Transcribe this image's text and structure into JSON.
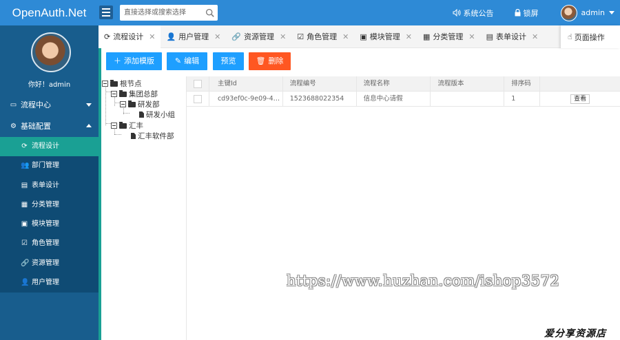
{
  "app": {
    "brand": "OpenAuth.Net"
  },
  "header": {
    "search_placeholder": "直接选择或搜索选择",
    "notice_label": "系统公告",
    "lock_label": "锁屏",
    "user_name": "admin"
  },
  "sidebar": {
    "greeting": "你好！admin",
    "groups": [
      {
        "label": "流程中心",
        "icon": "monitor-icon",
        "expanded": false
      },
      {
        "label": "基础配置",
        "icon": "gear-icon",
        "expanded": true
      }
    ],
    "items": [
      {
        "label": "流程设计",
        "icon": "refresh-icon",
        "active": true
      },
      {
        "label": "部门管理",
        "icon": "users-icon",
        "active": false
      },
      {
        "label": "表单设计",
        "icon": "form-icon",
        "active": false
      },
      {
        "label": "分类管理",
        "icon": "grid-icon",
        "active": false
      },
      {
        "label": "模块管理",
        "icon": "module-icon",
        "active": false
      },
      {
        "label": "角色管理",
        "icon": "check-square-icon",
        "active": false
      },
      {
        "label": "资源管理",
        "icon": "link-icon",
        "active": false
      },
      {
        "label": "用户管理",
        "icon": "user-icon",
        "active": false
      }
    ]
  },
  "tabs": [
    {
      "label": "流程设计",
      "icon": "refresh-icon",
      "active": true
    },
    {
      "label": "用户管理",
      "icon": "user-icon",
      "active": false
    },
    {
      "label": "资源管理",
      "icon": "link-icon",
      "active": false
    },
    {
      "label": "角色管理",
      "icon": "check-square-icon",
      "active": false
    },
    {
      "label": "模块管理",
      "icon": "module-icon",
      "active": false
    },
    {
      "label": "分类管理",
      "icon": "grid-icon",
      "active": false
    },
    {
      "label": "表单设计",
      "icon": "form-icon",
      "active": false
    }
  ],
  "page_action": {
    "label": "页面操作",
    "icon": "hand-pointer-icon"
  },
  "toolbar": {
    "add_label": "添加模版",
    "edit_label": "编辑",
    "preview_label": "预览",
    "delete_label": "删除",
    "colors": {
      "blue": "#1e9fff",
      "red": "#ff5722",
      "active_green": "#1aa094"
    }
  },
  "tree": {
    "root": "根节点",
    "group_hq": "集团总部",
    "dept_rd": "研发部",
    "team_rd": "研发小组",
    "huifeng": "汇丰",
    "huifeng_sw": "汇丰软件部"
  },
  "table": {
    "columns": [
      "主键Id",
      "流程编号",
      "流程名称",
      "流程版本",
      "排序码"
    ],
    "rows": [
      {
        "id": "cd93ef0c-9e09-461...",
        "code": "1523688022354",
        "name": "信息中心请假",
        "version": "",
        "sort": "1",
        "action": "查看"
      }
    ]
  },
  "watermark": {
    "url": "https://www.huzhan.com/ishop3572",
    "store": "爱分享资源店"
  }
}
